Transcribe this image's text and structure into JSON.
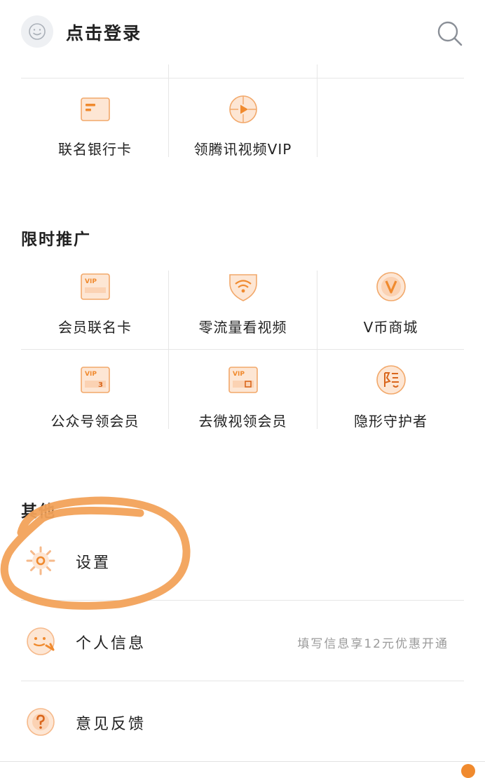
{
  "header": {
    "login_label": "点击登录",
    "avatar_icon": "smiley-face-icon",
    "search_icon": "search-icon"
  },
  "top_grid": [
    {
      "label": "联名银行卡",
      "icon": "bank-card-icon"
    },
    {
      "label": "领腾讯视频VIP",
      "icon": "video-play-icon"
    }
  ],
  "promo": {
    "title": "限时推广",
    "items": [
      {
        "label": "会员联名卡",
        "icon": "vip-card-icon"
      },
      {
        "label": "零流量看视频",
        "icon": "wifi-shield-icon"
      },
      {
        "label": "V币商城",
        "icon": "v-coin-icon"
      },
      {
        "label": "公众号领会员",
        "icon": "vip-3day-icon"
      },
      {
        "label": "去微视领会员",
        "icon": "vip-month-icon"
      },
      {
        "label": "隐形守护者",
        "icon": "hidden-guardian-icon"
      }
    ]
  },
  "other": {
    "title": "其他",
    "items": [
      {
        "label": "设置",
        "icon": "settings-gear-icon"
      },
      {
        "label": "个人信息",
        "tip": "填写信息享12元优惠开通",
        "icon": "personal-info-icon"
      },
      {
        "label": "意见反馈",
        "icon": "feedback-question-icon"
      }
    ]
  },
  "colors": {
    "accent": "#f08a2e",
    "accent_light": "#fde6d4",
    "text": "#222222",
    "muted": "#9a9a9a",
    "divider": "#e6e6e6"
  }
}
